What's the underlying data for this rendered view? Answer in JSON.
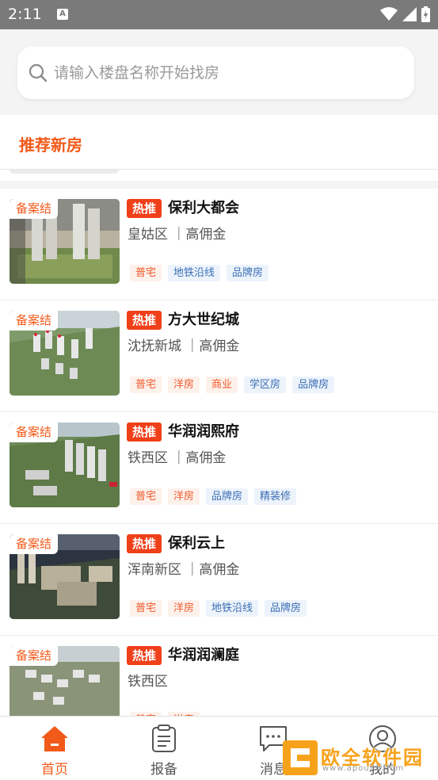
{
  "status_bar": {
    "time": "2:11",
    "notification_icon_label": "A"
  },
  "search": {
    "placeholder": "请输入楼盘名称开始找房"
  },
  "section": {
    "title": "推荐新房"
  },
  "listings": [
    {
      "badge": "备案结",
      "hot": "热推",
      "name": "保利大都会",
      "district": "皇姑区 ｜高佣金",
      "tags": [
        {
          "text": "普宅",
          "style": "orange"
        },
        {
          "text": "地铁沿线",
          "style": "blue"
        },
        {
          "text": "品牌房",
          "style": "blue"
        }
      ]
    },
    {
      "badge": "备案结",
      "hot": "热推",
      "name": "方大世纪城",
      "district": "沈抚新城 ｜高佣金",
      "tags": [
        {
          "text": "普宅",
          "style": "orange"
        },
        {
          "text": "洋房",
          "style": "orange"
        },
        {
          "text": "商业",
          "style": "orange"
        },
        {
          "text": "学区房",
          "style": "blue"
        },
        {
          "text": "品牌房",
          "style": "blue"
        }
      ]
    },
    {
      "badge": "备案结",
      "hot": "热推",
      "name": "华润润熙府",
      "district": "铁西区 ｜高佣金",
      "tags": [
        {
          "text": "普宅",
          "style": "orange"
        },
        {
          "text": "洋房",
          "style": "orange"
        },
        {
          "text": "品牌房",
          "style": "blue"
        },
        {
          "text": "精装修",
          "style": "blue"
        }
      ]
    },
    {
      "badge": "备案结",
      "hot": "热推",
      "name": "保利云上",
      "district": "浑南新区 ｜高佣金",
      "tags": [
        {
          "text": "普宅",
          "style": "orange"
        },
        {
          "text": "洋房",
          "style": "orange"
        },
        {
          "text": "地铁沿线",
          "style": "blue"
        },
        {
          "text": "品牌房",
          "style": "blue"
        }
      ]
    },
    {
      "badge": "备案结",
      "hot": "热推",
      "name": "华润润澜庭",
      "district": "铁西区",
      "tags": [
        {
          "text": "普宅",
          "style": "orange"
        },
        {
          "text": "洋房",
          "style": "orange"
        }
      ]
    }
  ],
  "tabbar": {
    "home": "首页",
    "report": "报备",
    "messages": "消息",
    "profile": "我的"
  },
  "watermark": {
    "text": "欧全软件园",
    "url": "www.apoujin.com"
  },
  "colors": {
    "accent": "#f25a1a",
    "hot_badge": "#f0401a",
    "tag_blue": "#3b6fb5"
  }
}
